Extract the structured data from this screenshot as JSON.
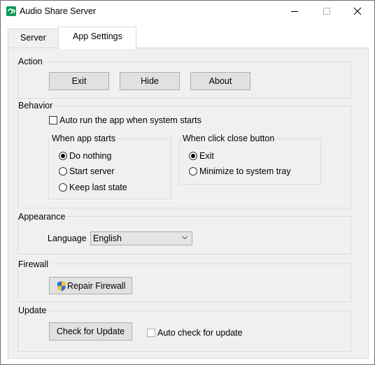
{
  "window": {
    "title": "Audio Share Server"
  },
  "tabs": [
    {
      "label": "Server",
      "active": false
    },
    {
      "label": "App Settings",
      "active": true
    }
  ],
  "action": {
    "label": "Action",
    "exit_label": "Exit",
    "hide_label": "Hide",
    "about_label": "About"
  },
  "behavior": {
    "label": "Behavior",
    "autorun": {
      "label": "Auto run the app when system starts",
      "checked": false
    },
    "when_starts": {
      "label": "When app starts",
      "options": [
        {
          "label": "Do nothing",
          "selected": true
        },
        {
          "label": "Start server",
          "selected": false
        },
        {
          "label": "Keep last state",
          "selected": false
        }
      ]
    },
    "when_close": {
      "label": "When click close button",
      "options": [
        {
          "label": "Exit",
          "selected": true
        },
        {
          "label": "Minimize to system tray",
          "selected": false
        }
      ]
    }
  },
  "appearance": {
    "label": "Appearance",
    "language_label": "Language",
    "language_value": "English"
  },
  "firewall": {
    "label": "Firewall",
    "repair_label": "Repair Firewall"
  },
  "update": {
    "label": "Update",
    "check_label": "Check for Update",
    "auto_check": {
      "label": "Auto check for update",
      "checked": false
    }
  },
  "colors": {
    "accent": "#0f9b59",
    "panel": "#f0f0f0",
    "button": "#e1e1e1"
  }
}
